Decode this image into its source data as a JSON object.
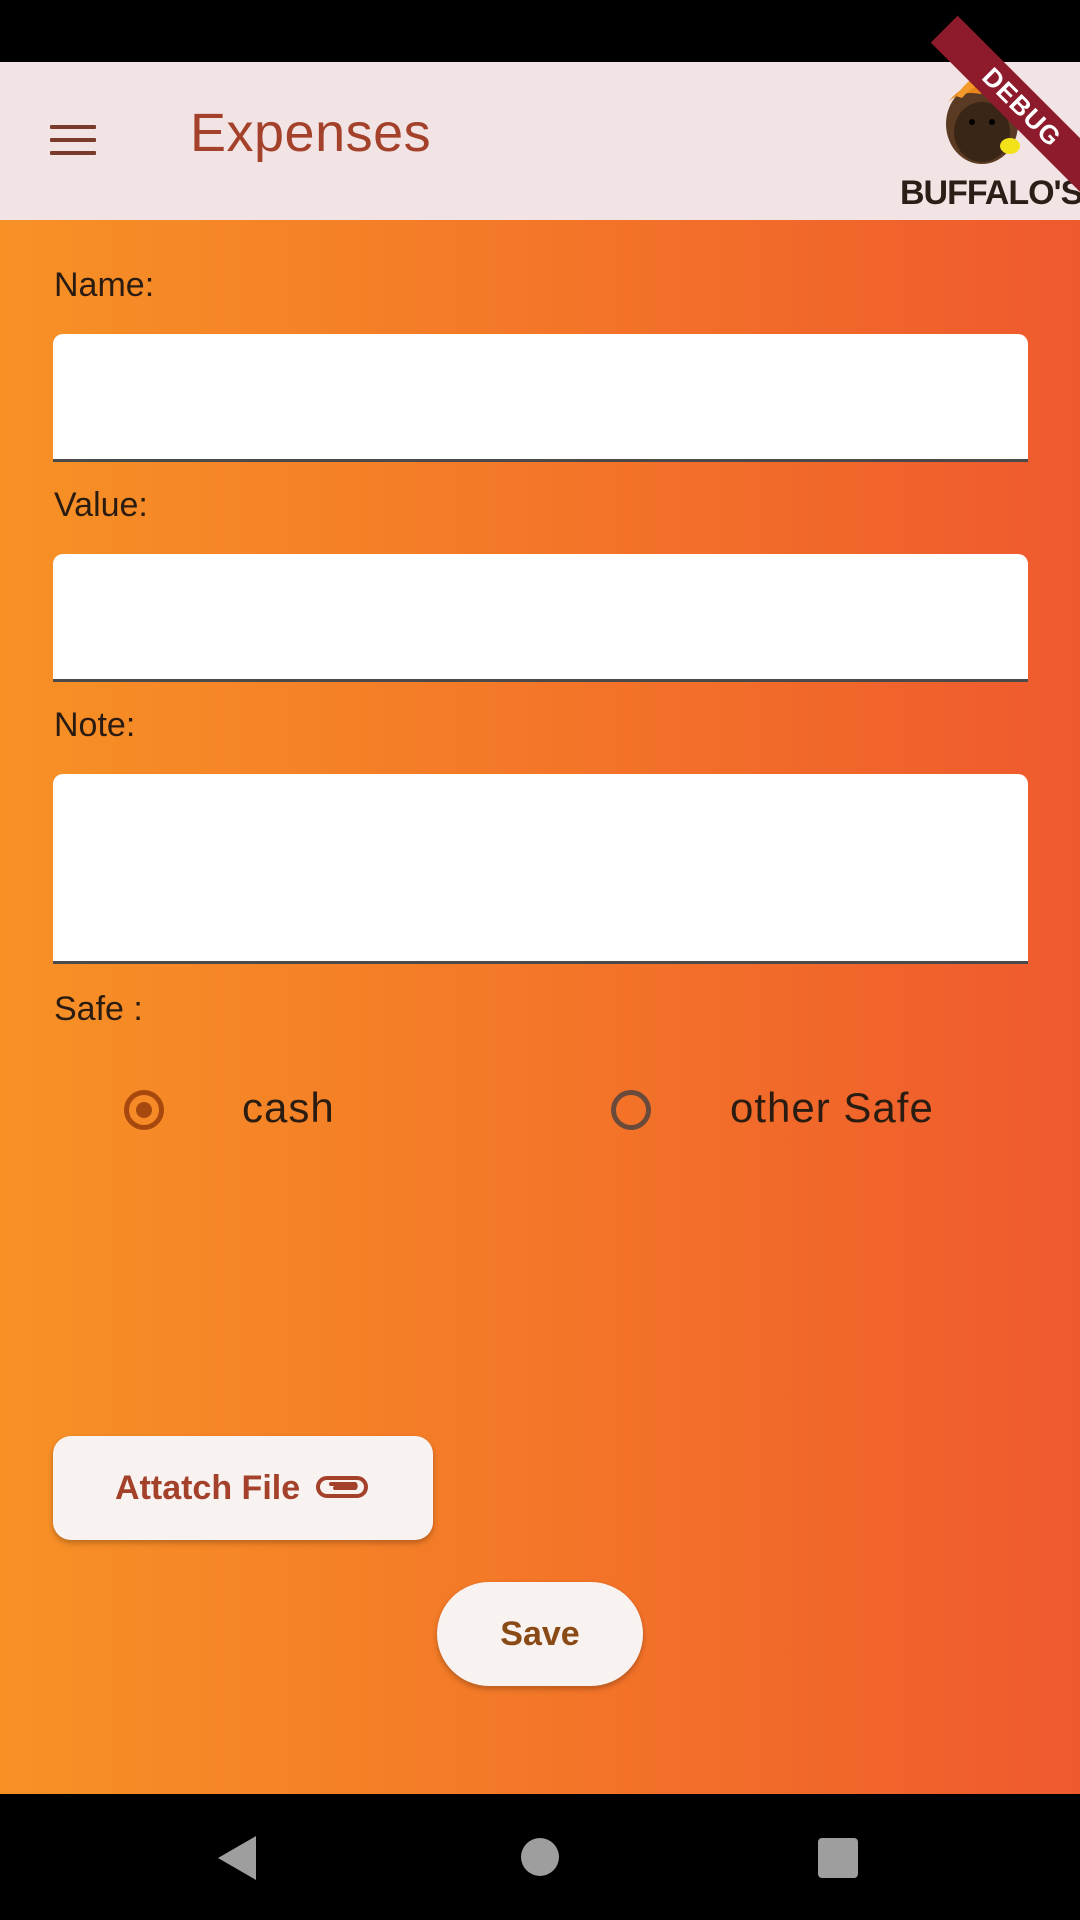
{
  "app_bar": {
    "title": "Expenses",
    "logo_text": "BUFFALO'S",
    "debug_label": "DEBUG"
  },
  "form": {
    "name_label": "Name:",
    "name_value": "",
    "value_label": "Value:",
    "value_value": "",
    "note_label": "Note:",
    "note_value": "",
    "safe_label": "Safe :",
    "safe_options": [
      {
        "label": "cash",
        "selected": true
      },
      {
        "label": "other Safe",
        "selected": false
      }
    ]
  },
  "buttons": {
    "attach_label": "Attatch File",
    "save_label": "Save"
  },
  "colors": {
    "app_bar_bg": "#f2e4e4",
    "title_color": "#a4412a",
    "gradient_start": "#f79126",
    "gradient_end": "#ef592e",
    "radio_selected": "#a7480f",
    "debug_ribbon": "#8e1b2c"
  },
  "icons": {
    "menu": "hamburger-menu-icon",
    "attach": "paperclip-icon",
    "nav_back": "back-triangle-icon",
    "nav_home": "home-circle-icon",
    "nav_recent": "recent-square-icon"
  }
}
